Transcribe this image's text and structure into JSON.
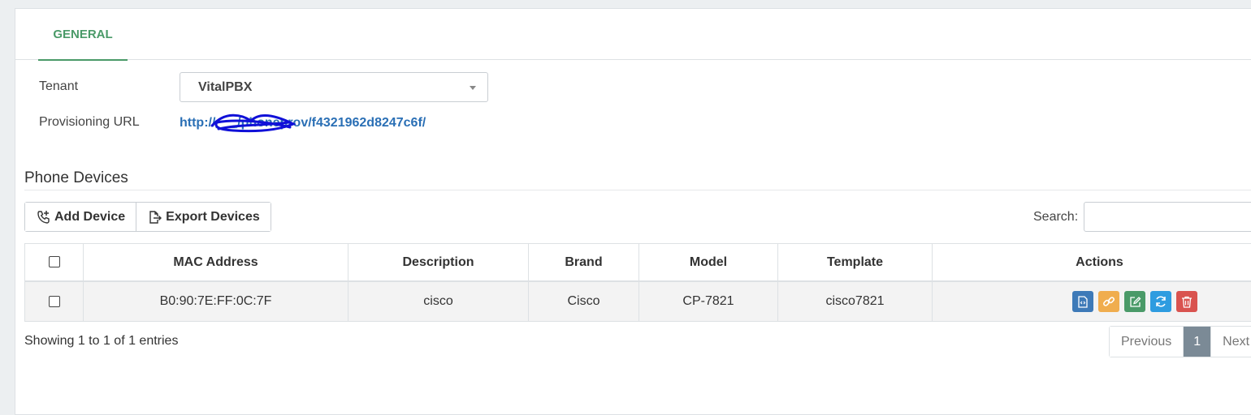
{
  "tabs": [
    {
      "label": "GENERAL",
      "active": true
    }
  ],
  "form": {
    "tenant_label": "Tenant",
    "tenant_value": "VitalPBX",
    "provisioning_label": "Provisioning URL",
    "provisioning_url": "http://___/phoneprov/f4321962d8247c6f/"
  },
  "section": {
    "title": "Phone Devices"
  },
  "toolbar": {
    "add_label": "Add Device",
    "export_label": "Export Devices"
  },
  "search": {
    "label": "Search:",
    "value": ""
  },
  "table": {
    "columns": [
      "MAC Address",
      "Description",
      "Brand",
      "Model",
      "Template",
      "Actions"
    ],
    "rows": [
      {
        "mac": "B0:90:7E:FF:0C:7F",
        "description": "cisco",
        "brand": "Cisco",
        "model": "CP-7821",
        "template": "cisco7821"
      }
    ]
  },
  "footer": {
    "showing": "Showing 1 to 1 of 1 entries"
  },
  "pagination": {
    "previous": "Previous",
    "current": "1",
    "next": "Next"
  },
  "colors": {
    "accent_green": "#4a9a68",
    "link_blue": "#2a6fb5",
    "action_blue": "#3e7ab8",
    "action_orange": "#f0ad4e",
    "action_green": "#4a9a68",
    "action_sky": "#2e9ce0",
    "action_red": "#d9534f"
  }
}
